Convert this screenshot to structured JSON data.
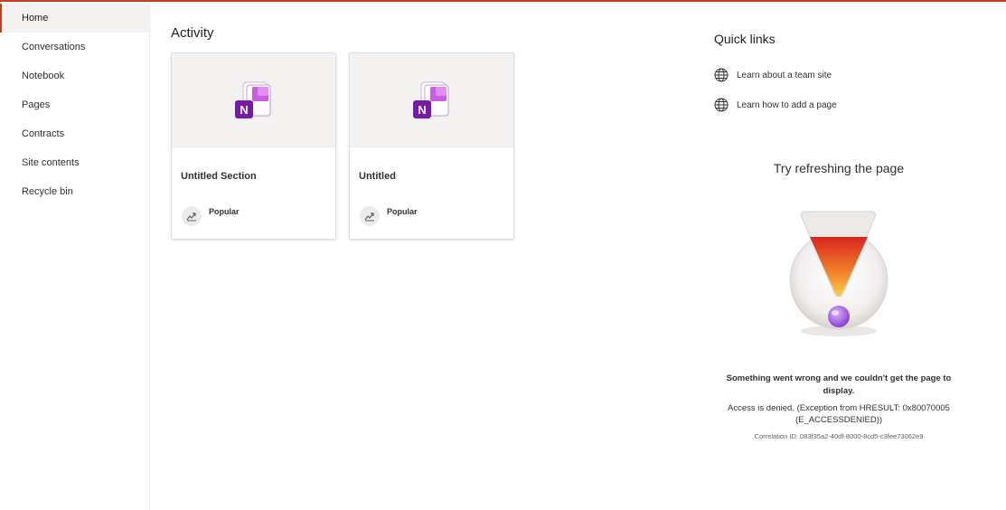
{
  "colors": {
    "accent": "#c43e1c",
    "onenote": "#7719aa"
  },
  "sidebar": {
    "items": [
      {
        "label": "Home",
        "selected": true
      },
      {
        "label": "Conversations"
      },
      {
        "label": "Notebook"
      },
      {
        "label": "Pages"
      },
      {
        "label": "Contracts"
      },
      {
        "label": "Site contents"
      },
      {
        "label": "Recycle bin"
      }
    ]
  },
  "activity": {
    "title": "Activity",
    "cards": [
      {
        "title": "Untitled Section",
        "meta": "Popular",
        "icon": "onenote-icon"
      },
      {
        "title": "Untitled",
        "meta": "Popular",
        "icon": "onenote-icon"
      }
    ]
  },
  "quick_links": {
    "title": "Quick links",
    "items": [
      {
        "label": "Learn about a team site",
        "icon": "globe-icon"
      },
      {
        "label": "Learn how to add a page",
        "icon": "globe-icon"
      }
    ]
  },
  "error": {
    "heading": "Try refreshing the page",
    "message": "Something went wrong and we couldn't get the page to display.",
    "detail": "Access is denied. (Exception from HRESULT: 0x80070005 (E_ACCESSDENIED))",
    "correlation": "Correlation ID: 083f35a2-40df-8000-8cd5-c3fee73062e9"
  }
}
